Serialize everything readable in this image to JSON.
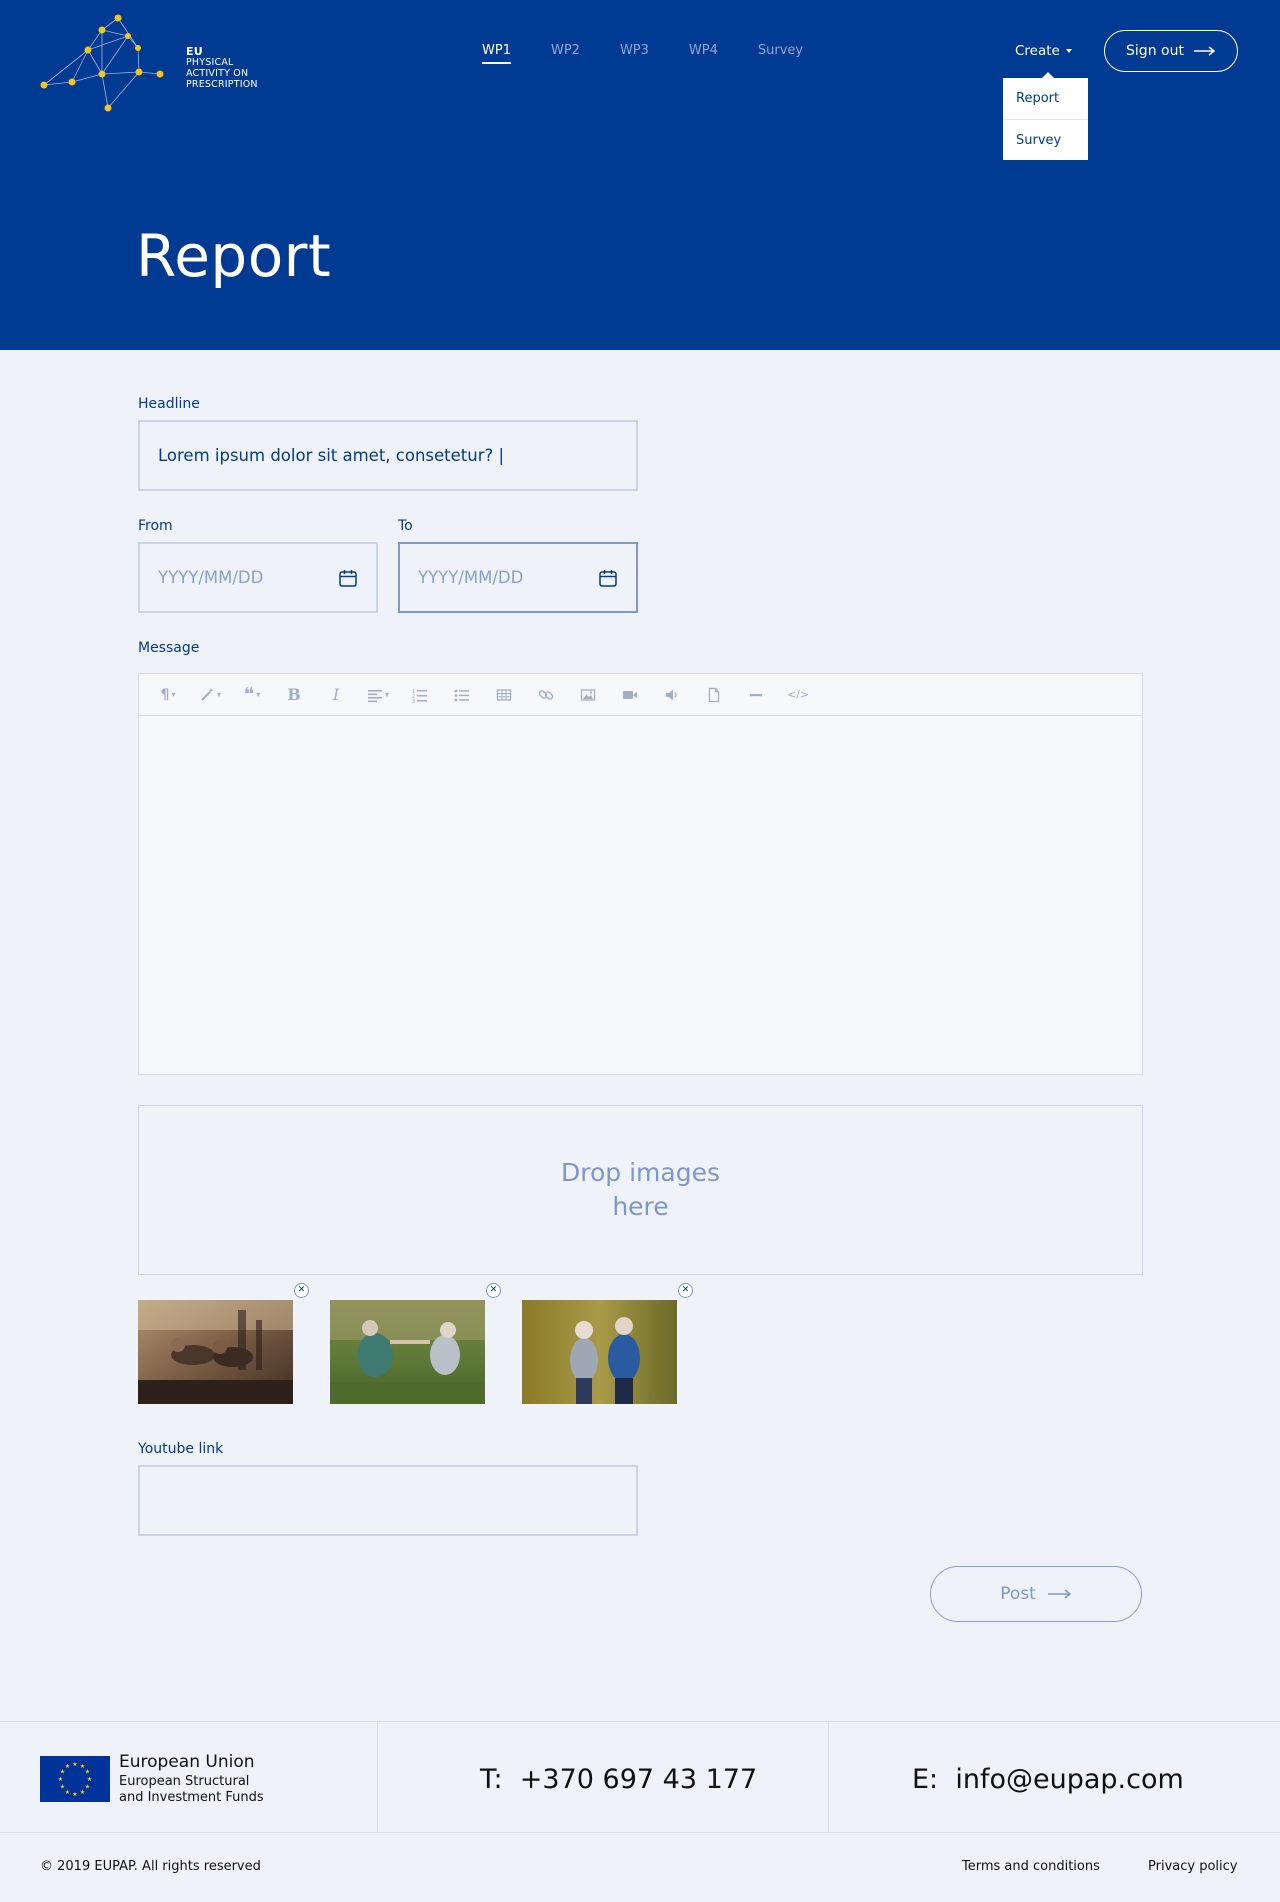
{
  "header": {
    "logo": {
      "line1": "EU",
      "line2": "PHYSICAL",
      "line3": "ACTIVITY ON",
      "line4": "PRESCRIPTION"
    },
    "nav": [
      "WP1",
      "WP2",
      "WP3",
      "WP4",
      "Survey"
    ],
    "create_label": "Create",
    "signout_label": "Sign out",
    "dropdown": [
      "Report",
      "Survey"
    ],
    "page_title": "Report"
  },
  "form": {
    "headline_label": "Headline",
    "headline_value": "Lorem ipsum dolor sit amet, consetetur? |",
    "from_label": "From",
    "to_label": "To",
    "date_placeholder": "YYYY/MM/DD",
    "message_label": "Message",
    "toolbar_icons": [
      "paragraph-icon",
      "magic-icon",
      "quote-icon",
      "bold-icon",
      "italic-icon",
      "align-icon",
      "ordered-list-icon",
      "unordered-list-icon",
      "table-icon",
      "link-icon",
      "image-icon",
      "video-icon",
      "audio-icon",
      "file-icon",
      "horizontal-rule-icon",
      "code-view-icon"
    ],
    "drop_line1": "Drop images",
    "drop_line2": "here",
    "youtube_label": "Youtube link",
    "post_label": "Post"
  },
  "footer": {
    "eu_title": "European Union",
    "eu_sub1": "European Structural",
    "eu_sub2": "and Investment Funds",
    "phone_prefix": "T:",
    "phone": "+370 697 43 177",
    "email_prefix": "E:",
    "email": "info@eupap.com",
    "copyright": "© 2019 EUPAP. All rights reserved",
    "terms": "Terms and conditions",
    "privacy": "Privacy policy"
  },
  "colors": {
    "brand_blue": "#003a93",
    "accent_yellow": "#f5c518",
    "page_bg": "#f0f2f9"
  }
}
